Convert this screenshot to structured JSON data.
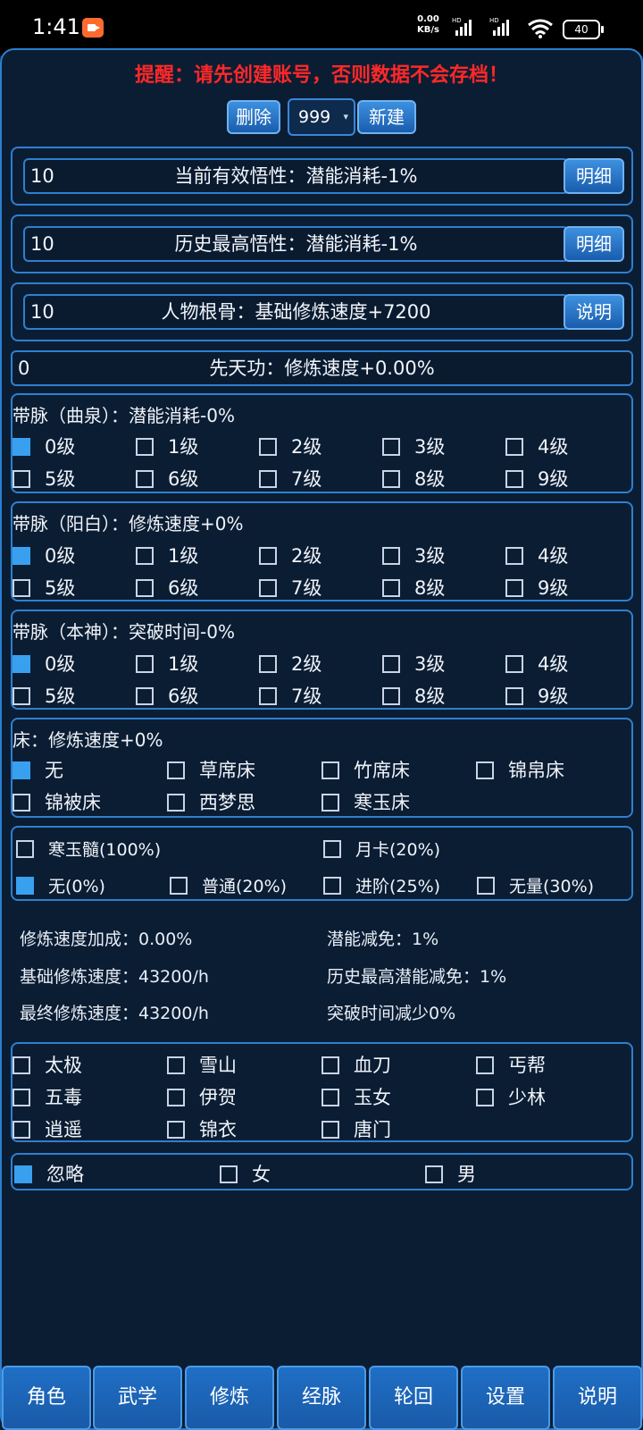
{
  "status_bar": {
    "time": "1:41",
    "net_speed_value": "0.00",
    "net_speed_unit": "KB/s",
    "battery": "40"
  },
  "warning": "提醒：请先创建账号，否则数据不会存档！",
  "account": {
    "delete_label": "删除",
    "selected": "999",
    "create_label": "新建"
  },
  "comprehension": {
    "value": "10",
    "label": "当前有效悟性：潜能消耗-1%",
    "button": "明细"
  },
  "history_comprehension": {
    "value": "10",
    "label": "历史最高悟性：潜能消耗-1%",
    "button": "明细"
  },
  "bone": {
    "value": "10",
    "label": "人物根骨：基础修炼速度+7200",
    "button": "说明"
  },
  "innate": {
    "value": "0",
    "label": "先天功：修炼速度+0.00%"
  },
  "meridians": [
    {
      "title": "带脉（曲泉）：潜能消耗-0%",
      "selected": 0,
      "levels": [
        "0级",
        "1级",
        "2级",
        "3级",
        "4级",
        "5级",
        "6级",
        "7级",
        "8级",
        "9级"
      ]
    },
    {
      "title": "带脉（阳白）：修炼速度+0%",
      "selected": 0,
      "levels": [
        "0级",
        "1级",
        "2级",
        "3级",
        "4级",
        "5级",
        "6级",
        "7级",
        "8级",
        "9级"
      ]
    },
    {
      "title": "带脉（本神）：突破时间-0%",
      "selected": 0,
      "levels": [
        "0级",
        "1级",
        "2级",
        "3级",
        "4级",
        "5级",
        "6级",
        "7级",
        "8级",
        "9级"
      ]
    }
  ],
  "bed": {
    "title": "床：修炼速度+0%",
    "selected": 0,
    "options": [
      "无",
      "草席床",
      "竹席床",
      "锦帛床",
      "锦被床",
      "西梦思",
      "寒玉床"
    ]
  },
  "items": {
    "row1": [
      {
        "label": "寒玉髓(100%)",
        "checked": false
      },
      {
        "label": "月卡(20%)",
        "checked": false
      }
    ],
    "row2": [
      {
        "label": "无(0%)",
        "checked": true
      },
      {
        "label": "普通(20%)",
        "checked": false
      },
      {
        "label": "进阶(25%)",
        "checked": false
      },
      {
        "label": "无量(30%)",
        "checked": false
      }
    ]
  },
  "stats": {
    "speed_bonus": "修炼速度加成：0.00%",
    "potential_reduce": "潜能减免：1%",
    "base_speed": "基础修炼速度：43200/h",
    "history_potential_reduce": "历史最高潜能减免：1%",
    "final_speed": "最终修炼速度：43200/h",
    "breakthrough_reduce": "突破时间减少0%"
  },
  "sects": [
    "太极",
    "雪山",
    "血刀",
    "丐帮",
    "五毒",
    "伊贺",
    "玉女",
    "少林",
    "逍遥",
    "锦衣",
    "唐门"
  ],
  "gender": {
    "selected": 0,
    "options": [
      "忽略",
      "女",
      "男"
    ]
  },
  "tabs": [
    "角色",
    "武学",
    "修炼",
    "经脉",
    "轮回",
    "设置",
    "说明"
  ],
  "colors": {
    "background": "#0b1d33",
    "accent": "#2f7fd0",
    "checked": "#39a0f0",
    "warning": "#ff2828"
  }
}
